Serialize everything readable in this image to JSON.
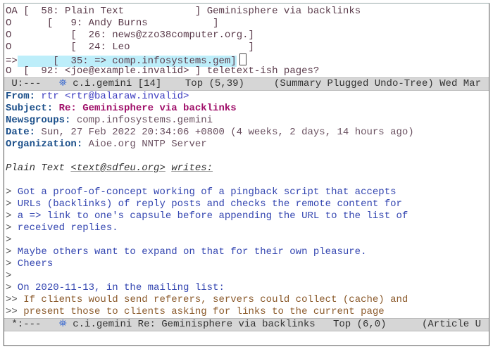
{
  "summary": {
    "lines": [
      {
        "mark": "OA",
        "pre": " [  ",
        "num": "58",
        "author": "Plain Text            ",
        "post": "] ",
        "subject": "Geminisphere via backlinks"
      },
      {
        "mark": "O ",
        "pre": "     [   ",
        "num": "9",
        "author": "Andy Burns           ",
        "post": "]",
        "subject": ""
      },
      {
        "mark": "O ",
        "pre": "         [  ",
        "num": "26",
        "author": "news@zzo38computer.org.",
        "post": "]",
        "subject": ""
      },
      {
        "mark": "O ",
        "pre": "         [  ",
        "num": "24",
        "author": "Leo                    ",
        "post": "]",
        "subject": ""
      },
      {
        "mark": "=>",
        "pre": "      [  ",
        "num": "35",
        "author": "=> comp.infosystems.gem",
        "post": "]",
        "subject": ""
      },
      {
        "mark": "O ",
        "pre": " [  ",
        "num": "92",
        "author": "<joe@example.invalid> ",
        "post": "] ",
        "subject": "teletext-ish pages?"
      }
    ],
    "modeline": {
      "status": "U:---",
      "group": "c.i.gemini [14]",
      "position": "Top (5,39)",
      "modes": "(Summary Plugged Undo-Tree) Wed Mar"
    }
  },
  "article": {
    "headers": [
      {
        "key": "From:",
        "value": "rtr <rtr@balaraw.invalid>"
      },
      {
        "key": "Subject:",
        "value": "Re: Geminisphere via backlinks"
      },
      {
        "key": "Newsgroups:",
        "value": "comp.infosystems.gemini"
      },
      {
        "key": "Date:",
        "value": "Sun, 27 Feb 2022 20:34:06 +0800 (4 weeks, 2 days, 14 hours ago)"
      },
      {
        "key": "Organization:",
        "value": "Aioe.org NNTP Server"
      }
    ],
    "citation": {
      "name": "Plain Text",
      "email": "<text@sdfeu.org>",
      "writes": "writes:"
    },
    "body": [
      {
        "marker": ">",
        "level": 1,
        "text": " Got a proof-of-concept working of a pingback script that accepts"
      },
      {
        "marker": ">",
        "level": 1,
        "text": " URLs (backlinks) of reply posts and checks the remote content for"
      },
      {
        "marker": ">",
        "level": 1,
        "text": " a => link to one's capsule before appending the URL to the list of"
      },
      {
        "marker": ">",
        "level": 1,
        "text": " received replies."
      },
      {
        "marker": ">",
        "level": 1,
        "text": ""
      },
      {
        "marker": ">",
        "level": 1,
        "text": " Maybe others want to expand on that for their own pleasure."
      },
      {
        "marker": ">",
        "level": 1,
        "text": " Cheers"
      },
      {
        "marker": ">",
        "level": 1,
        "text": ""
      },
      {
        "marker": ">",
        "level": 1,
        "text": " On 2020-11-13, in the mailing list:"
      },
      {
        "marker": ">>",
        "level": 2,
        "text": " If clients would send referers, servers could collect (cache) and"
      },
      {
        "marker": ">>",
        "level": 2,
        "text": " present those to clients asking for links to the current page"
      }
    ],
    "modeline": {
      "status": "*:---",
      "group": "c.i.gemini",
      "subject": "Re: Geminisphere via backlinks",
      "position": "Top (6,0)",
      "modes": "(Article U"
    }
  },
  "colors": {
    "highlight": "#bdeefa",
    "modeline": "#d6d6d6",
    "quote1": "#3345b0",
    "quote2": "#8b5a2b"
  }
}
